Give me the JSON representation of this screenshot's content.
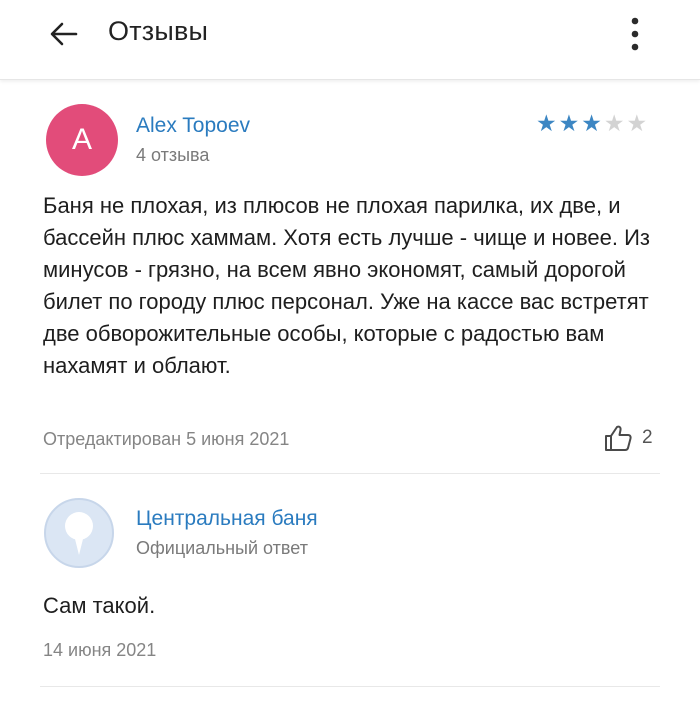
{
  "header": {
    "title": "Отзывы",
    "back_icon": "arrow-left-icon",
    "menu_icon": "more-vertical-icon"
  },
  "review": {
    "avatar_letter": "A",
    "author": "Alex Topoev",
    "author_meta": "4 отзыва",
    "rating": 3,
    "rating_max": 5,
    "text": "Баня не плохая, из плюсов не плохая парилка, их две, и бассейн плюс хаммам. Хотя есть лучше - чище и новее. Из минусов - грязно, на всем явно экономят, самый дорогой билет по городу плюс персонал. Уже на кассе вас встретят две обворожительные особы, которые с радостью вам нахамят и облают.",
    "date": "Отредактирован 5 июня 2021",
    "likes": "2"
  },
  "reply": {
    "author": "Центральная баня",
    "author_meta": "Официальный ответ",
    "text": "Сам такой.",
    "date": "14 июня 2021"
  },
  "colors": {
    "accent": "#2a7bbf",
    "avatar": "#e24c7a",
    "star_on": "#3c86c3",
    "star_off": "#d3d3d3"
  }
}
